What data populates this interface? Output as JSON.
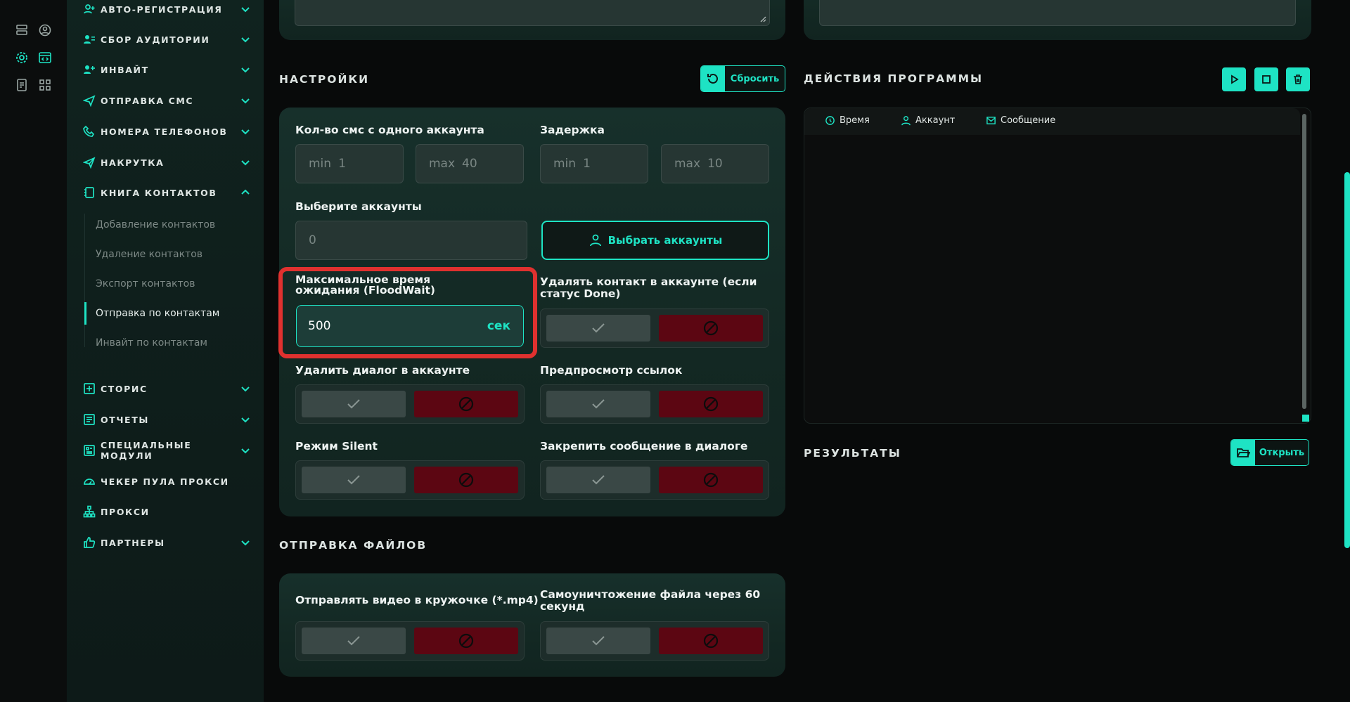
{
  "sidebar": {
    "items": [
      {
        "label": "Авто-регистрация",
        "icon": "user-plus-icon",
        "chevron": "down"
      },
      {
        "label": "Сбор аудитории",
        "icon": "users-icon",
        "chevron": "down"
      },
      {
        "label": "Инвайт",
        "icon": "user-add-icon",
        "chevron": "down"
      },
      {
        "label": "Отправка смс",
        "icon": "send-icon",
        "chevron": "down"
      },
      {
        "label": "Номера телефонов",
        "icon": "phone-icon",
        "chevron": "down"
      },
      {
        "label": "Накрутка",
        "icon": "megaphone-icon",
        "chevron": "down"
      },
      {
        "label": "Книга контактов",
        "icon": "contacts-book-icon",
        "chevron": "up"
      },
      {
        "label": "Сторис",
        "icon": "plus-square-icon",
        "chevron": "down"
      },
      {
        "label": "Отчеты",
        "icon": "report-icon",
        "chevron": "down"
      },
      {
        "label": "Специальные модули",
        "icon": "modules-icon",
        "chevron": "down"
      },
      {
        "label": "Чекер пула прокси",
        "icon": "gauge-icon",
        "chevron": "none"
      },
      {
        "label": "Прокси",
        "icon": "network-icon",
        "chevron": "none"
      },
      {
        "label": "Партнеры",
        "icon": "thumbs-up-icon",
        "chevron": "down"
      }
    ],
    "sub_items": [
      {
        "label": "Добавление контактов",
        "active": false
      },
      {
        "label": "Удаление контактов",
        "active": false
      },
      {
        "label": "Экспорт контактов",
        "active": false
      },
      {
        "label": "Отправка по контактам",
        "active": true
      },
      {
        "label": "Инвайт по контактам",
        "active": false
      }
    ]
  },
  "settings": {
    "title": "НАСТРОЙКИ",
    "reset_label": "Сбросить",
    "sms_per_account": {
      "label": "Кол-во смс с одного аккаунта",
      "min_ph": "min",
      "min_val": "1",
      "max_ph": "max",
      "max_val": "40"
    },
    "delay": {
      "label": "Задержка",
      "min_ph": "min",
      "min_val": "1",
      "max_ph": "max",
      "max_val": "10"
    },
    "select_accounts": {
      "label": "Выберите аккаунты",
      "value": "0",
      "button": "Выбрать аккаунты"
    },
    "floodwait": {
      "label": "Максимальное время ожидания (FloodWait)",
      "value": "500",
      "unit": "сек"
    },
    "delete_contact": {
      "label": "Удалять контакт в аккаунте (если статус Done)"
    },
    "delete_dialog": {
      "label": "Удалить диалог в аккаунте"
    },
    "link_preview": {
      "label": "Предпросмотр ссылок"
    },
    "silent": {
      "label": "Режим Silent"
    },
    "pin_message": {
      "label": "Закрепить сообщение в диалоге"
    }
  },
  "files": {
    "title": "ОТПРАВКА ФАЙЛОВ",
    "video_circle": {
      "label": "Отправлять видео в кружочке (*.mp4)"
    },
    "self_destruct": {
      "label": "Самоуничтожение файла через 60 секунд"
    }
  },
  "actions": {
    "title": "ДЕЙСТВИЯ ПРОГРАММЫ",
    "columns": [
      "Время",
      "Аккаунт",
      "Сообщение"
    ]
  },
  "results": {
    "title": "РЕЗУЛЬТАТЫ",
    "open_label": "Открыть"
  },
  "colors": {
    "accent": "#1ee3c4",
    "danger": "#5c0612",
    "highlight": "#e0312f"
  }
}
